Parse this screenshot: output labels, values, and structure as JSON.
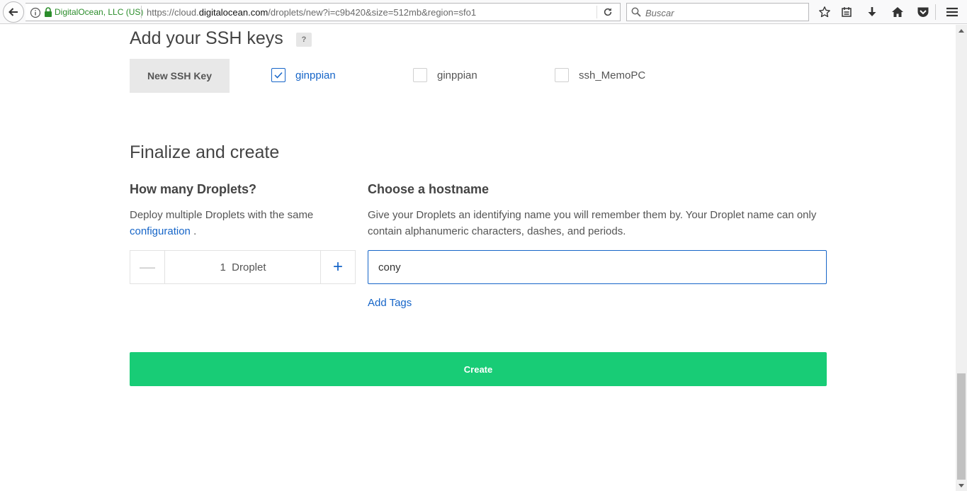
{
  "browser": {
    "identity": "DigitalOcean, LLC (US)",
    "url_prefix": "https://cloud.",
    "url_host": "digitalocean.com",
    "url_path": "/droplets/new?i=c9b420&size=512mb&region=sfo1",
    "search_placeholder": "Buscar",
    "icons": [
      "back-icon",
      "info-icon",
      "lock-icon",
      "reload-icon",
      "search-icon",
      "bookmark-star-icon",
      "reading-list-icon",
      "downloads-icon",
      "home-icon",
      "pocket-icon",
      "menu-icon"
    ]
  },
  "ssh": {
    "title": "Add your SSH keys",
    "help": "?",
    "new_key_button": "New SSH Key",
    "keys": [
      {
        "label": "ginppian",
        "checked": true
      },
      {
        "label": "ginppian",
        "checked": false
      },
      {
        "label": "ssh_MemoPC",
        "checked": false
      }
    ]
  },
  "finalize": {
    "title": "Finalize and create",
    "count": {
      "heading": "How many Droplets?",
      "desc": "Deploy multiple Droplets with the same",
      "link": "configuration",
      "desc_end": " .",
      "minus": "—",
      "value": "1  Droplet",
      "plus": "+"
    },
    "hostname": {
      "heading": "Choose a hostname",
      "desc": "Give your Droplets an identifying name you will remember them by. Your Droplet name can only contain alphanumeric characters, dashes, and periods.",
      "value": "cony",
      "add_tags": "Add Tags"
    },
    "create_button": "Create"
  },
  "colors": {
    "accent": "#1665c8",
    "create": "#18cc76",
    "secure": "#2b8d2b"
  }
}
